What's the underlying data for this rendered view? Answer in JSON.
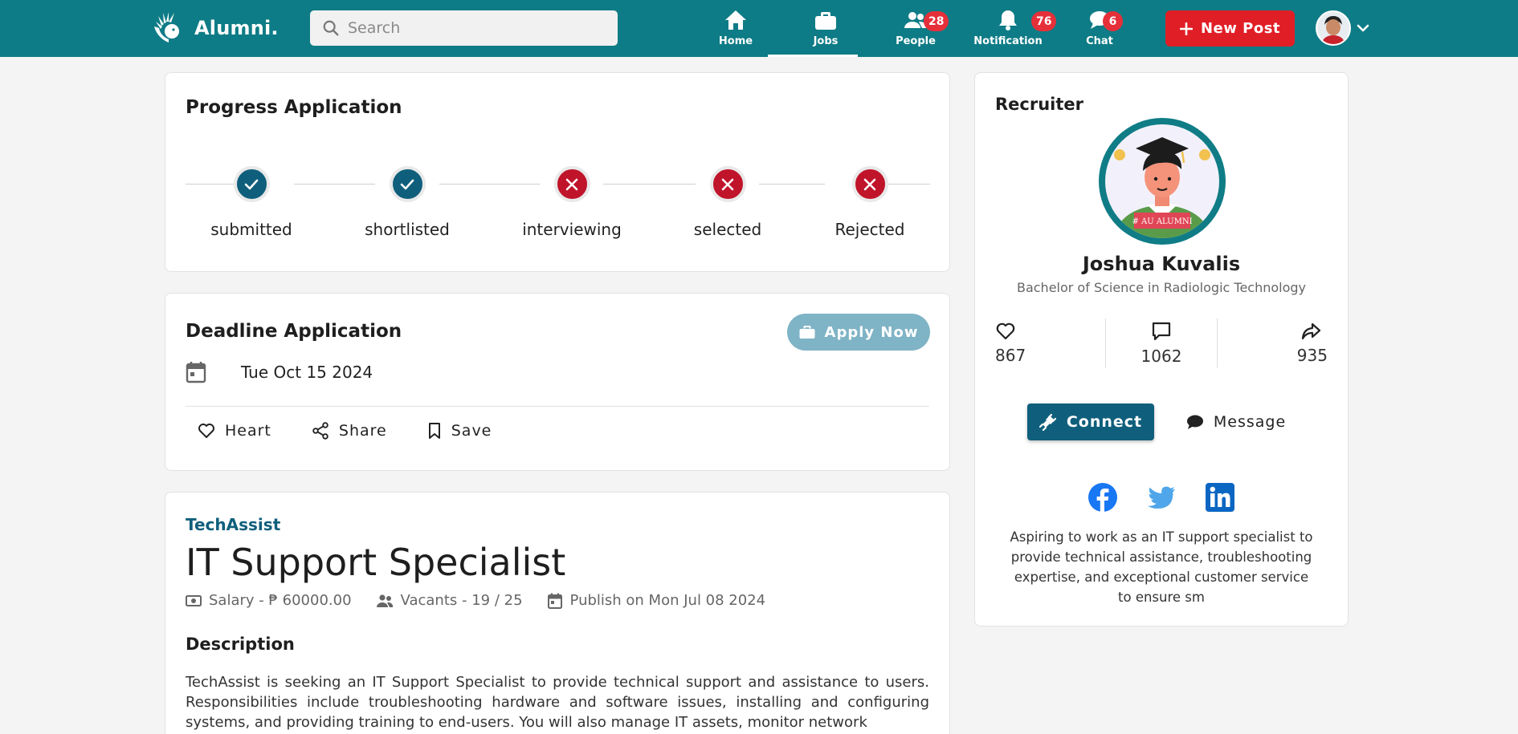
{
  "app": {
    "brand": "Alumni."
  },
  "search": {
    "placeholder": "Search"
  },
  "nav": {
    "home": "Home",
    "jobs": "Jobs",
    "people": "People",
    "people_badge": "28",
    "notification": "Notification",
    "notification_badge": "76",
    "chat": "Chat",
    "chat_badge": "6",
    "new_post": "New Post"
  },
  "progress": {
    "title": "Progress Application",
    "steps": [
      {
        "label": "submitted",
        "status": "done"
      },
      {
        "label": "shortlisted",
        "status": "done"
      },
      {
        "label": "interviewing",
        "status": "failed"
      },
      {
        "label": "selected",
        "status": "failed"
      },
      {
        "label": "Rejected",
        "status": "failed"
      }
    ]
  },
  "deadline": {
    "title": "Deadline Application",
    "apply_label": "Apply Now",
    "date": "Tue Oct 15 2024",
    "actions": {
      "heart": "Heart",
      "share": "Share",
      "save": "Save"
    }
  },
  "job": {
    "company": "TechAssist",
    "title": "IT Support Specialist",
    "salary": "Salary - ₱ 60000.00",
    "vacants": "Vacants - 19 / 25",
    "published": "Publish on Mon Jul 08 2024",
    "description_title": "Description",
    "description": "TechAssist is seeking an IT Support Specialist to provide technical support and assistance to users. Responsibilities include troubleshooting hardware and software issues, installing and configuring systems, and providing training to end-users. You will also manage IT assets, monitor network"
  },
  "recruiter": {
    "title": "Recruiter",
    "avatar_banner": "# AU ALUMNI",
    "name": "Joshua Kuvalis",
    "degree": "Bachelor of Science in Radiologic Technology",
    "likes": "867",
    "comments": "1062",
    "shares": "935",
    "connect": "Connect",
    "message": "Message",
    "bio": "Aspiring to work as an IT support specialist to provide technical assistance, troubleshooting expertise, and exceptional customer service to ensure sm"
  },
  "colors": {
    "primary": "#0e7c86",
    "accent": "#0f5f7c",
    "danger": "#c0142b",
    "new_post": "#e01e26",
    "badge": "#e5303a"
  }
}
